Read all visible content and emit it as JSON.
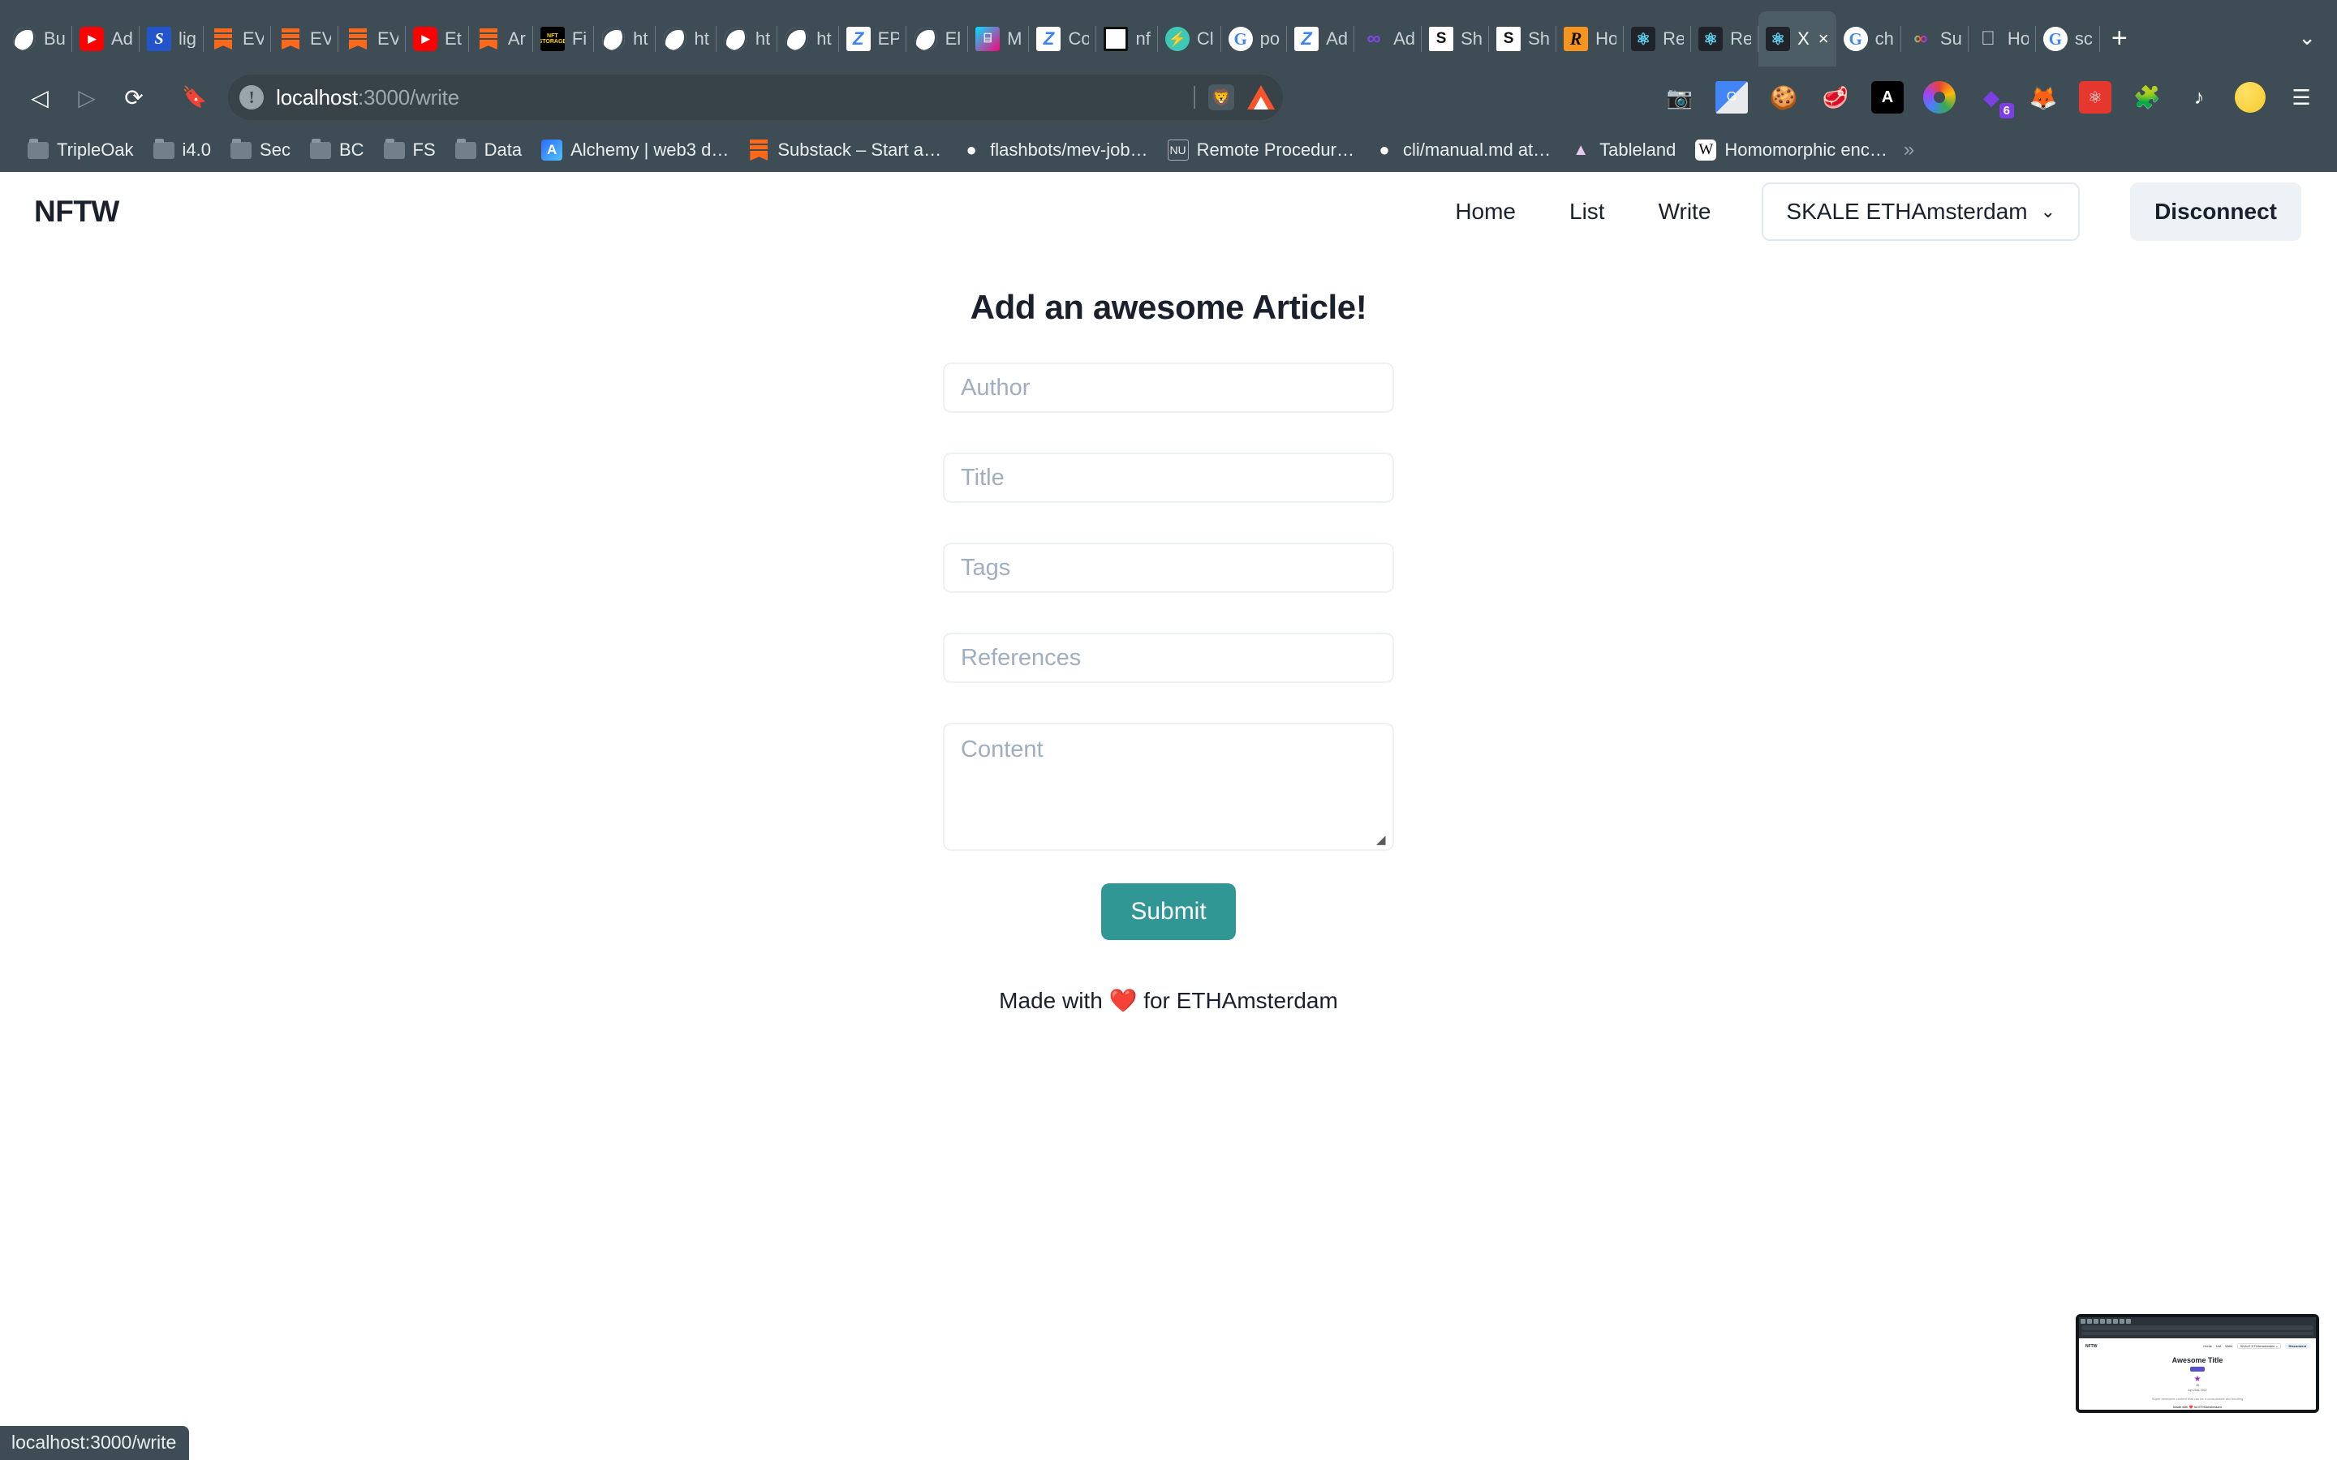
{
  "browser": {
    "name": "brave",
    "tabs": [
      {
        "label": "Bu",
        "icon": "globe-icon"
      },
      {
        "label": "Ad",
        "icon": "youtube-icon"
      },
      {
        "label": "lig",
        "icon": "blue-s-icon"
      },
      {
        "label": "EV",
        "icon": "substack-icon"
      },
      {
        "label": "EV",
        "icon": "substack-icon"
      },
      {
        "label": "EV",
        "icon": "substack-icon"
      },
      {
        "label": "Et",
        "icon": "youtube-icon"
      },
      {
        "label": "Ar",
        "icon": "substack-icon"
      },
      {
        "label": "Fi",
        "icon": "nftstorage-icon"
      },
      {
        "label": "ht",
        "icon": "globe-icon"
      },
      {
        "label": "ht",
        "icon": "globe-icon"
      },
      {
        "label": "ht",
        "icon": "globe-icon"
      },
      {
        "label": "ht",
        "icon": "globe-icon"
      },
      {
        "label": "EP",
        "icon": "zora-icon"
      },
      {
        "label": "El",
        "icon": "globe-icon"
      },
      {
        "label": "M",
        "icon": "mirror-icon"
      },
      {
        "label": "Co",
        "icon": "zora-icon"
      },
      {
        "label": "nf",
        "icon": "square-icon"
      },
      {
        "label": "Cl",
        "icon": "teal-bolt-icon"
      },
      {
        "label": "po",
        "icon": "google-icon"
      },
      {
        "label": "Ad",
        "icon": "zora-icon"
      },
      {
        "label": "Ad",
        "icon": "polygon-icon"
      },
      {
        "label": "Sh",
        "icon": "s-doc-icon"
      },
      {
        "label": "Sh",
        "icon": "s-doc-icon"
      },
      {
        "label": "Ho",
        "icon": "r-orange-icon"
      },
      {
        "label": "Re",
        "icon": "react-icon"
      },
      {
        "label": "Re",
        "icon": "react-icon"
      },
      {
        "label": "X",
        "icon": "react-icon",
        "active": true,
        "close": "×"
      },
      {
        "label": "ch",
        "icon": "google-icon"
      },
      {
        "label": "Su",
        "icon": "superfluid-icon"
      },
      {
        "label": "Ho",
        "icon": "apple-icon"
      },
      {
        "label": "sc",
        "icon": "google-icon"
      }
    ],
    "new_tab_label": "+",
    "tab_list_caret": "⌄",
    "toolbar": {
      "back": "◁",
      "forward": "▷",
      "reload": "⟳",
      "bookmark_star": "⎙",
      "url_host": "localhost",
      "url_rest": ":3000/write",
      "site_info_icon": "!",
      "extensions": [
        {
          "name": "screenshot-extension",
          "glyph": "▣"
        },
        {
          "name": "google-translate-extension",
          "glyph": "G"
        },
        {
          "name": "cookie-extension",
          "glyph": "●"
        },
        {
          "name": "honey-extension",
          "glyph": "◆"
        },
        {
          "name": "angular-extension",
          "glyph": "A"
        },
        {
          "name": "colorpicker-extension",
          "glyph": ""
        },
        {
          "name": "layers-extension",
          "glyph": "◆",
          "badge": "6"
        },
        {
          "name": "metamask-extension",
          "glyph": "🦊"
        },
        {
          "name": "react-devtools-extension",
          "glyph": "⚛"
        },
        {
          "name": "puzzle-extensions",
          "glyph": "🧩"
        },
        {
          "name": "reading-list",
          "glyph": "♪"
        },
        {
          "name": "profile-avatar",
          "glyph": ""
        },
        {
          "name": "browser-menu",
          "glyph": "☰"
        }
      ]
    },
    "bookmarks": [
      {
        "label": "TripleOak",
        "icon": "folder-icon"
      },
      {
        "label": "i4.0",
        "icon": "folder-icon"
      },
      {
        "label": "Sec",
        "icon": "folder-icon"
      },
      {
        "label": "BC",
        "icon": "folder-icon"
      },
      {
        "label": "FS",
        "icon": "folder-icon"
      },
      {
        "label": "Data",
        "icon": "folder-icon"
      },
      {
        "label": "Alchemy | web3 d…",
        "icon": "alchemy-icon"
      },
      {
        "label": "Substack – Start a…",
        "icon": "substack-icon"
      },
      {
        "label": "flashbots/mev-job…",
        "icon": "github-icon"
      },
      {
        "label": "Remote Procedur…",
        "icon": "rpc-icon"
      },
      {
        "label": "cli/manual.md at…",
        "icon": "github-icon"
      },
      {
        "label": "Tableland",
        "icon": "tableland-icon"
      },
      {
        "label": "Homomorphic enc…",
        "icon": "wikipedia-icon"
      }
    ],
    "bookmarks_overflow": "»",
    "status_bubble": "localhost:3000/write"
  },
  "site": {
    "brand": "NFTW",
    "nav_links": [
      "Home",
      "List",
      "Write"
    ],
    "network": {
      "label": "SKALE ETHAmsterdam",
      "caret": "⌄"
    },
    "disconnect_label": "Disconnect",
    "form": {
      "title": "Add an awesome Article!",
      "fields": [
        {
          "name": "author",
          "placeholder": "Author",
          "value": ""
        },
        {
          "name": "title",
          "placeholder": "Title",
          "value": ""
        },
        {
          "name": "tags",
          "placeholder": "Tags",
          "value": ""
        },
        {
          "name": "references",
          "placeholder": "References",
          "value": ""
        }
      ],
      "content_placeholder": "Content",
      "content_value": "",
      "submit_label": "Submit"
    },
    "footer": "Made with ❤️ for ETHAmsterdam",
    "accent_color": "#319795"
  },
  "thumbnail": {
    "brand": "NFTW",
    "nav_links": [
      "Home",
      "List",
      "Write"
    ],
    "network": "SKALE ETHAmsterdam ⌄",
    "disconnect": "Disconnect",
    "title": "Awesome Title",
    "badge": "Web3",
    "author": "JD",
    "date": "Apr 23rd, 2022",
    "body": "Super awesome content that can be a consumable and exciting",
    "footer": "Made with ❤️ for ETHAmsterdam"
  }
}
